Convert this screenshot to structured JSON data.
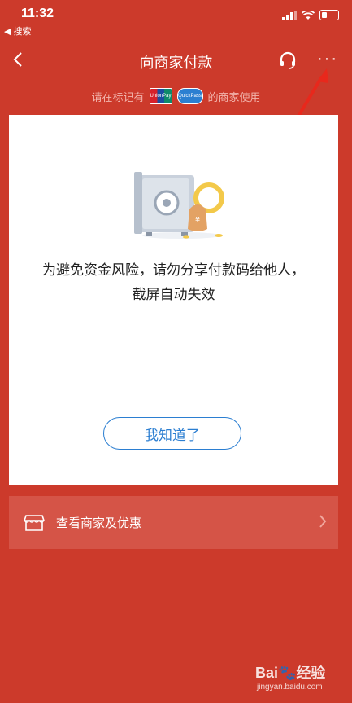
{
  "status_bar": {
    "time": "11:32",
    "back_app": "◀ 搜索"
  },
  "nav": {
    "title": "向商家付款",
    "more": "···"
  },
  "hint": {
    "before": "请在标记有",
    "after": "的商家使用",
    "logo_unionpay": "UnionPay",
    "logo_quickpass": "QuickPass"
  },
  "card": {
    "message": "为避免资金风险，请勿分享付款码给他人，截屏自动失效",
    "button": "我知道了"
  },
  "merchant": {
    "label": "查看商家及优惠"
  },
  "watermark": {
    "text": "Bai🐾经验",
    "sub": "jingyan.baidu.com"
  },
  "colors": {
    "background": "#cc3a2b",
    "accent": "#2b7ed1",
    "row": "#d55447"
  }
}
